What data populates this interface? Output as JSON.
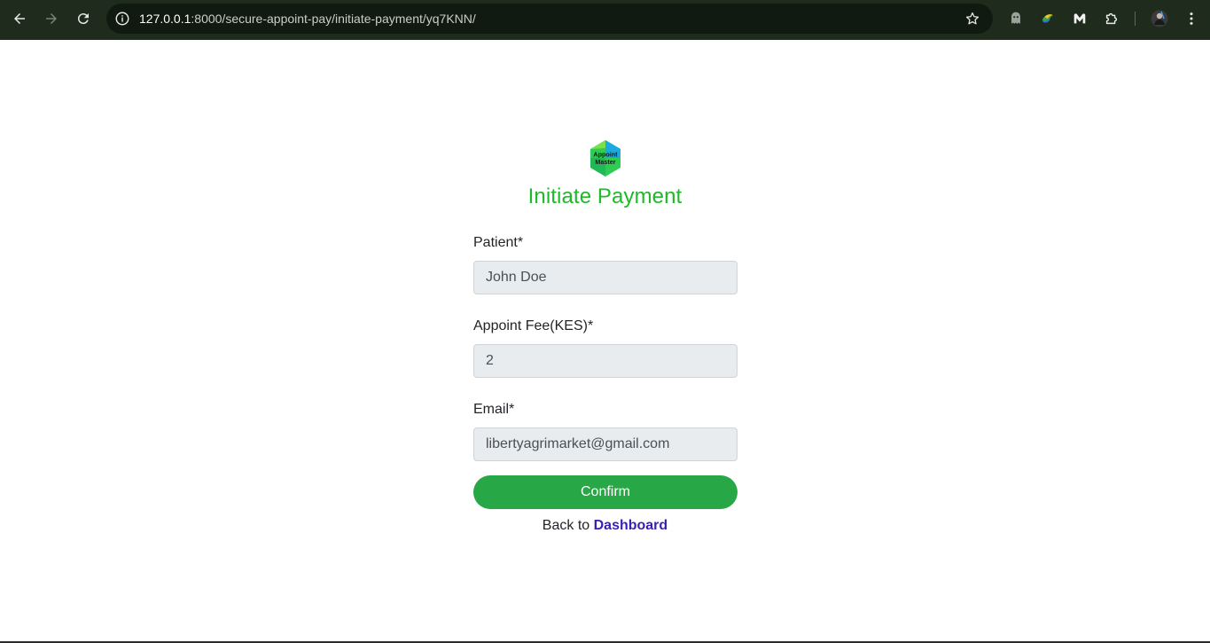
{
  "browser": {
    "url_host": "127.0.0.1",
    "url_path": ":8000/secure-appoint-pay/initiate-payment/yq7KNN/"
  },
  "icons": {
    "back": "arrow-left-icon",
    "forward": "arrow-right-icon",
    "reload": "reload-icon",
    "site_info": "info-icon",
    "bookmark": "star-icon",
    "extensions": [
      "ghost-extension-icon",
      "color-extension-icon",
      "malwarebytes-icon",
      "puzzle-extensions-icon"
    ],
    "profile": "profile-avatar-icon",
    "menu": "kebab-menu-icon"
  },
  "logo": {
    "line1": "Appoint",
    "line2": "Master"
  },
  "page": {
    "title": "Initiate Payment",
    "title_color": "#1fb929"
  },
  "form": {
    "patient_label": "Patient*",
    "patient_value": "John Doe",
    "fee_label": "Appoint Fee(KES)*",
    "fee_value": "2",
    "email_label": "Email*",
    "email_value": "libertyagrimarket@gmail.com",
    "confirm_label": "Confirm",
    "confirm_color": "#27a745"
  },
  "footer": {
    "back_text": "Back to",
    "dashboard_link": "Dashboard",
    "link_color": "#3b1fb5"
  }
}
